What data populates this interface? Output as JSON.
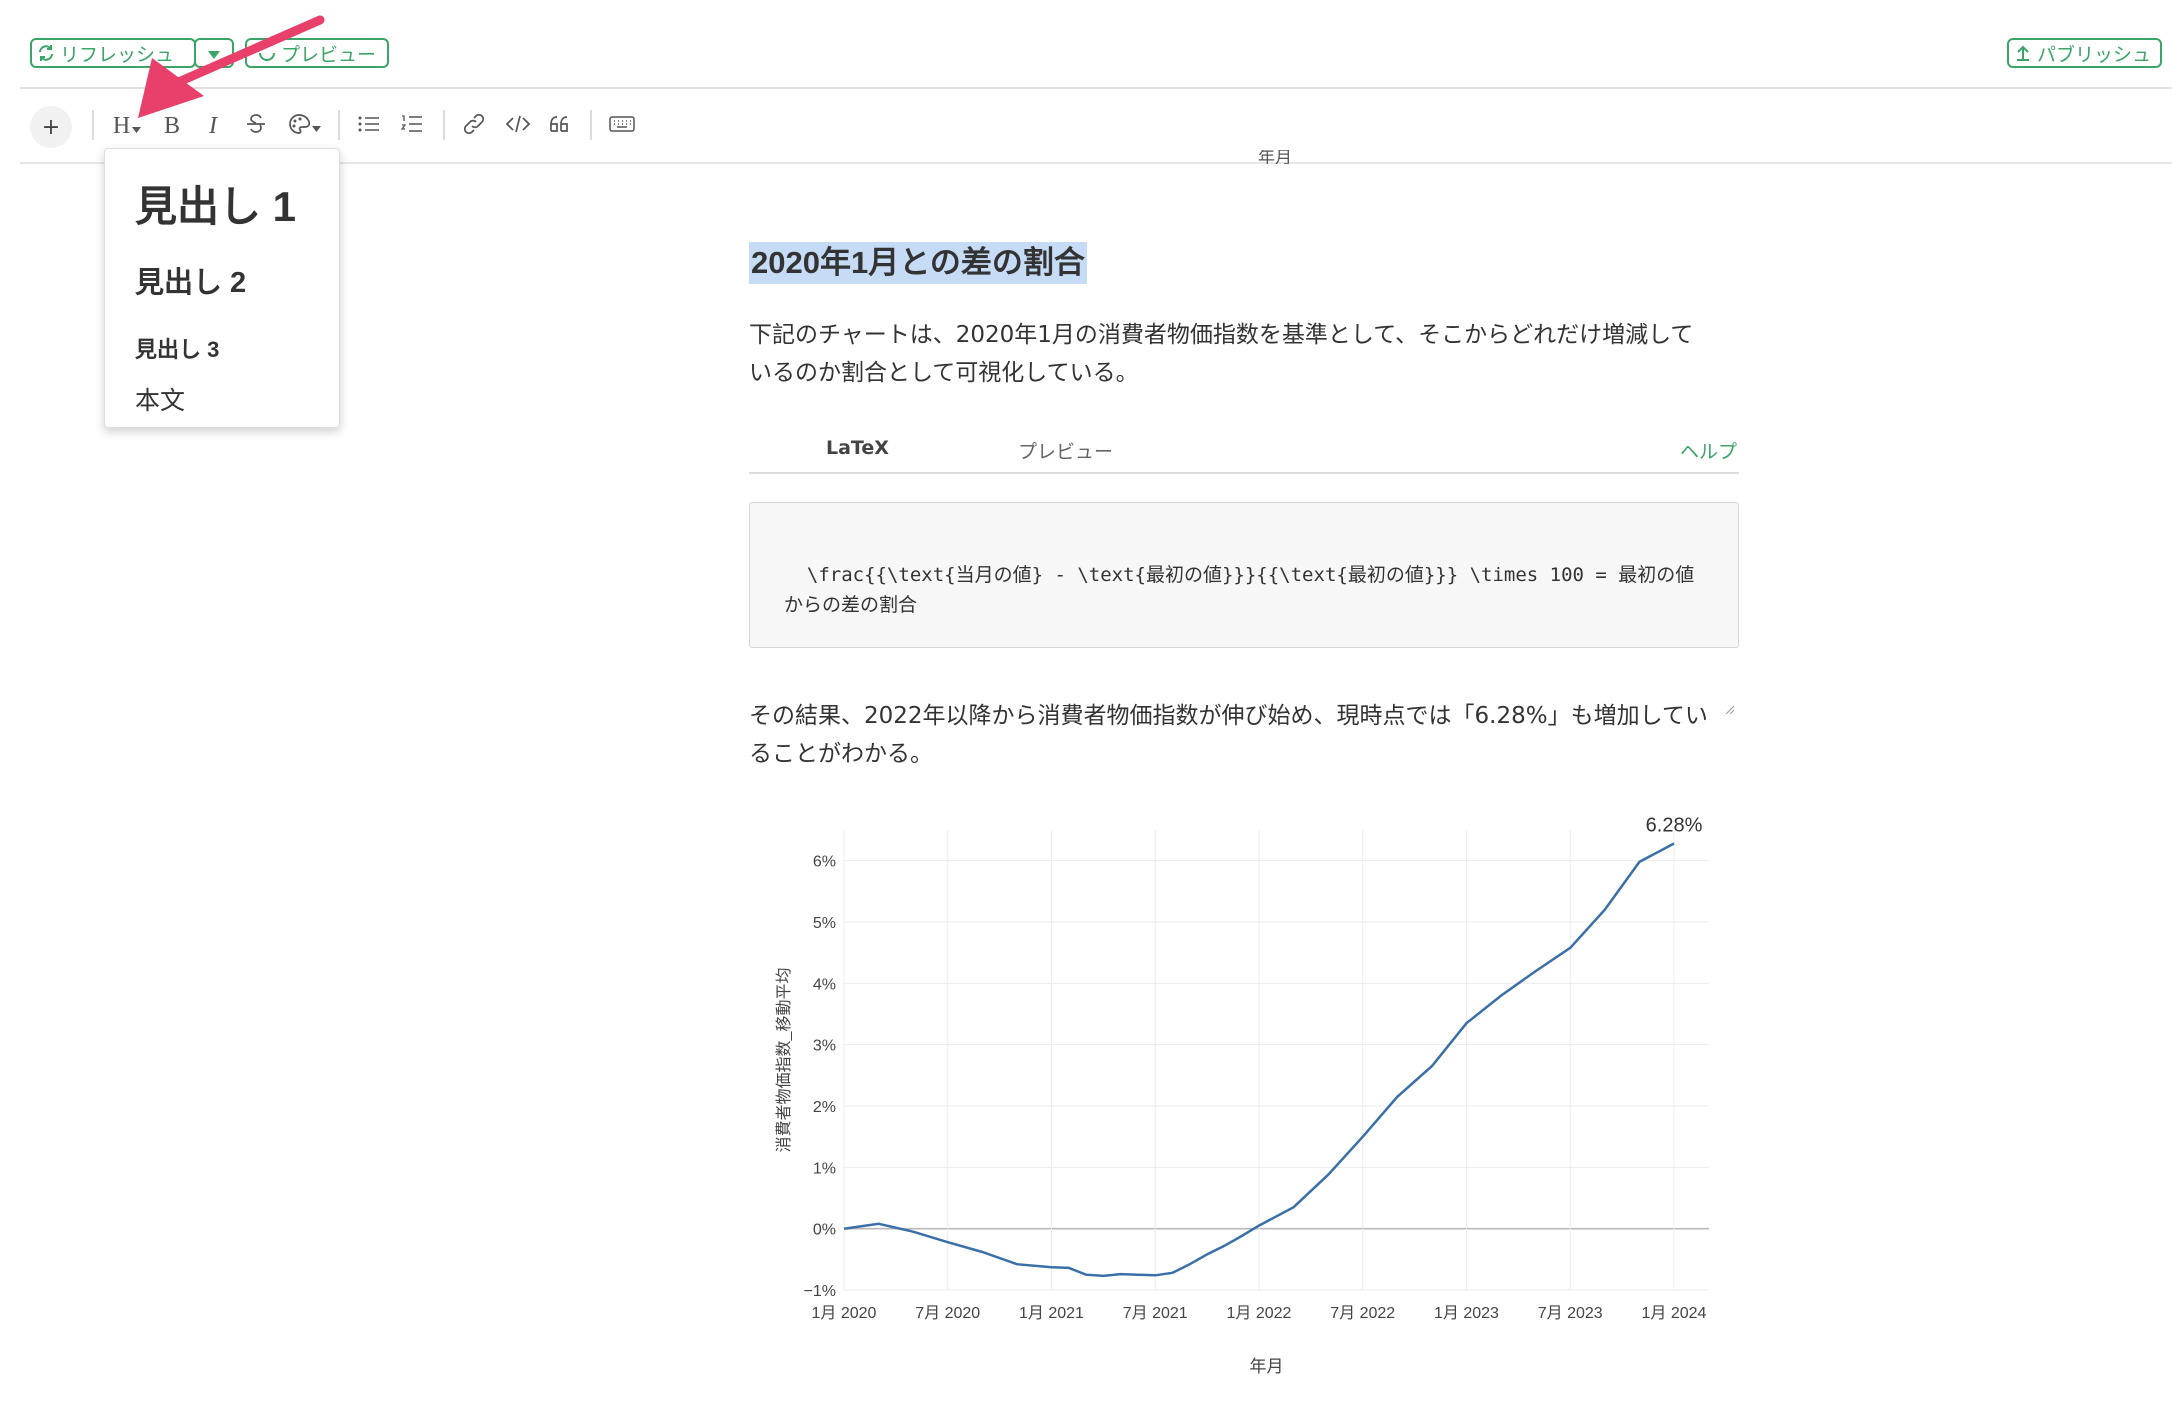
{
  "topbar": {
    "refresh_label": "リフレッシュ",
    "preview_label": "プレビュー",
    "publish_label": "パブリッシュ"
  },
  "toolbar": {
    "plus_label": "+",
    "heading_label": "H",
    "bold_label": "B",
    "italic_label": "I"
  },
  "heading_menu": {
    "items": [
      "見出し 1",
      "見出し 2",
      "見出し 3",
      "本文"
    ]
  },
  "annotation": {
    "arrow_color": "#e8406b"
  },
  "document": {
    "top_clipped_text": "年月",
    "heading": "2020年1月との差の割合",
    "intro_line1": "下記のチャートは、2020年1月の消費者物価指数を基準として、そこからどれだけ増減して",
    "intro_line2": "いるのか割合として可視化している。",
    "tabs": {
      "latex": "LaTeX",
      "preview": "プレビュー",
      "help": "ヘルプ"
    },
    "latex_code": "\\frac{{\\text{当月の値} - \\text{最初の値}}}{{\\text{最初の値}}} \\times 100 = 最初の値からの差の割合",
    "result_line1": "その結果、2022年以降から消費者物価指数が伸び始め、現時点では「6.28%」も増加してい",
    "result_line2": "ることがわかる。"
  },
  "colors": {
    "accent_green": "#3aa566",
    "line_blue": "#3a6fa8",
    "highlight": "#c6dbf6"
  },
  "chart_data": {
    "type": "line",
    "xlabel": "年月",
    "ylabel": "消費者物価指数_移動平均",
    "x_ticks": [
      "1月 2020",
      "7月 2020",
      "1月 2021",
      "7月 2021",
      "1月 2022",
      "7月 2022",
      "1月 2023",
      "7月 2023",
      "1月 2024"
    ],
    "y_ticks": [
      "−1%",
      "0%",
      "1%",
      "2%",
      "3%",
      "4%",
      "5%",
      "6%"
    ],
    "ylim": [
      -1,
      6.5
    ],
    "grid": true,
    "annotation": "6.28%",
    "series": [
      {
        "x": [
          "2020-01",
          "2020-03",
          "2020-05",
          "2020-07",
          "2020-09",
          "2020-11",
          "2021-01",
          "2021-02",
          "2021-03",
          "2021-04",
          "2021-05",
          "2021-06",
          "2021-07",
          "2021-08",
          "2021-09",
          "2021-10",
          "2021-11",
          "2021-12",
          "2022-01",
          "2022-03",
          "2022-05",
          "2022-07",
          "2022-09",
          "2022-11",
          "2023-01",
          "2023-03",
          "2023-05",
          "2023-07",
          "2023-09",
          "2023-11",
          "2024-01"
        ],
        "y": [
          0.0,
          0.08,
          -0.05,
          -0.22,
          -0.38,
          -0.58,
          -0.63,
          -0.64,
          -0.75,
          -0.77,
          -0.74,
          -0.75,
          -0.76,
          -0.72,
          -0.58,
          -0.42,
          -0.28,
          -0.12,
          0.05,
          0.35,
          0.88,
          1.5,
          2.15,
          2.65,
          3.35,
          3.8,
          4.2,
          4.58,
          5.2,
          5.98,
          6.28
        ]
      }
    ]
  }
}
